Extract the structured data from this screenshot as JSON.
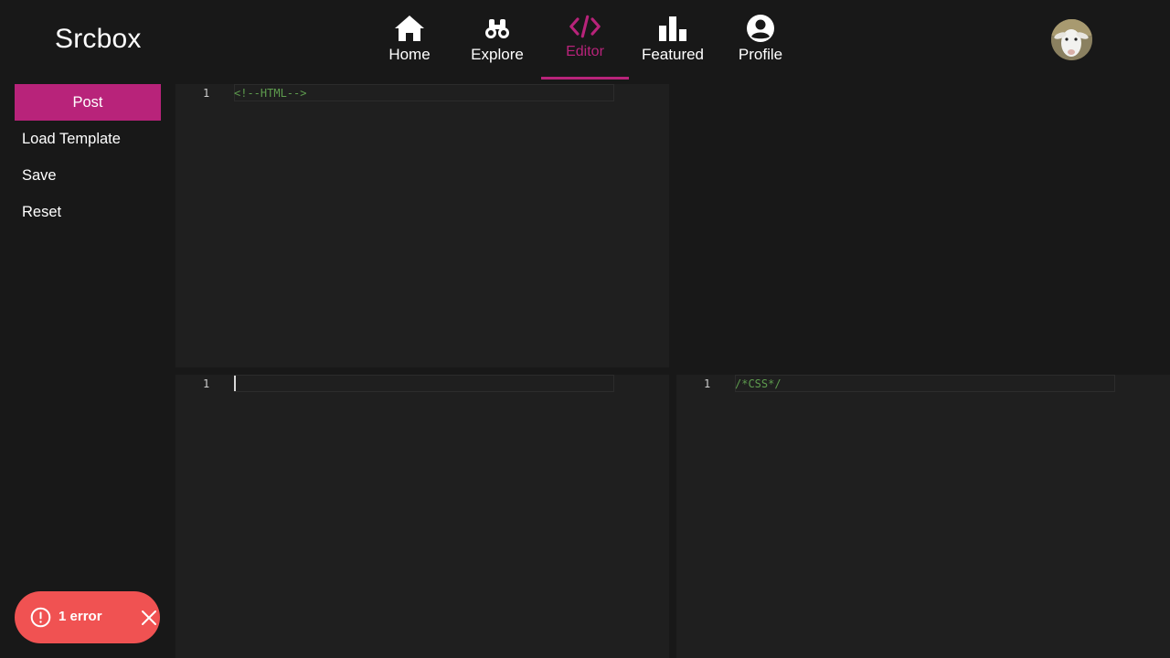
{
  "app": {
    "brand": "Srcbox"
  },
  "nav": {
    "items": [
      {
        "label": "Home",
        "icon": "home-icon"
      },
      {
        "label": "Explore",
        "icon": "binoculars-icon"
      },
      {
        "label": "Editor",
        "icon": "code-icon",
        "active": true
      },
      {
        "label": "Featured",
        "icon": "bar-chart-icon"
      },
      {
        "label": "Profile",
        "icon": "user-circle-icon"
      }
    ]
  },
  "user": {
    "avatar_icon": "goat-avatar"
  },
  "sidebar": {
    "post": "Post",
    "load_template": "Load Template",
    "save": "Save",
    "reset": "Reset"
  },
  "editors": {
    "html": {
      "line_number": "1",
      "code": "<!--HTML-->"
    },
    "js": {
      "line_number": "1",
      "code": ""
    },
    "css": {
      "line_number": "1",
      "code": "/*CSS*/"
    }
  },
  "toast": {
    "text": "1 error",
    "icon": "alert-circle-icon"
  },
  "colors": {
    "accent": "#b8237a",
    "background": "#181818",
    "editor_bg": "#1f1f1f",
    "error": "#f05252",
    "comment": "#5e9c4e"
  }
}
